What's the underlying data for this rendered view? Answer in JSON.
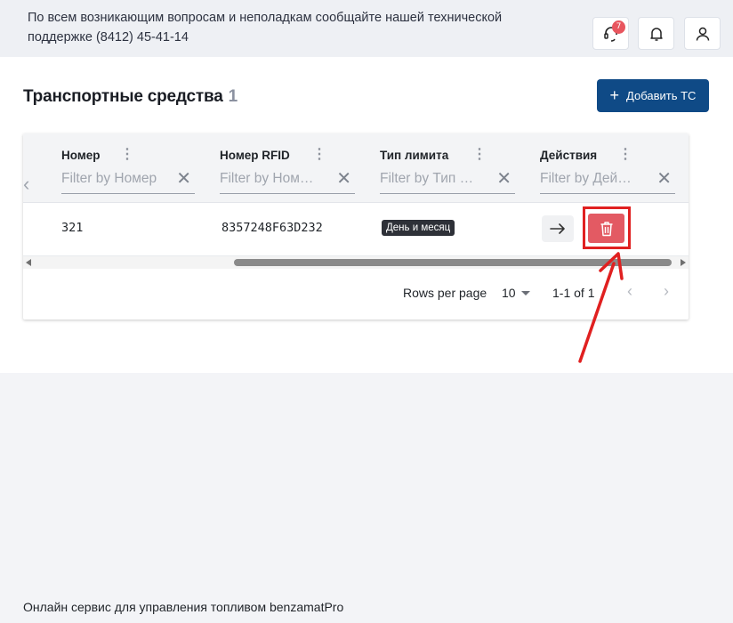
{
  "header": {
    "notice": "По всем возникающим вопросам и неполадкам сообщайте нашей технической поддержке (8412) 45-41-14",
    "support_badge": "7"
  },
  "page": {
    "title": "Транспортные средства",
    "count": "1",
    "add_button": "Добавить ТС"
  },
  "grid": {
    "columns": [
      {
        "header": "Номер",
        "placeholder": "Filter by Номер"
      },
      {
        "header": "Номер RFID",
        "placeholder": "Filter by Ном…"
      },
      {
        "header": "Тип лимита",
        "placeholder": "Filter by Тип …"
      },
      {
        "header": "Действия",
        "placeholder": "Filter by Дей…"
      }
    ],
    "rows": [
      {
        "number": "321",
        "rfid": "8357248F63D232",
        "limit_type": "День и месяц"
      }
    ]
  },
  "pagination": {
    "rows_per_page_label": "Rows per page",
    "rows_per_page_value": "10",
    "range": "1-1 of 1"
  },
  "footer": {
    "text": "Онлайн сервис для управления топливом benzamatPro"
  },
  "colors": {
    "primary": "#0f4a86",
    "delete": "#e35a63",
    "highlight": "#e02020",
    "badge": "#e8555e"
  },
  "icons": [
    "support-headset-icon",
    "bell-icon",
    "user-icon",
    "plus-icon",
    "arrow-right-icon",
    "trash-icon",
    "chevron-left-icon",
    "chevron-right-icon",
    "clear-filter-icon",
    "kebab-menu-icon"
  ]
}
